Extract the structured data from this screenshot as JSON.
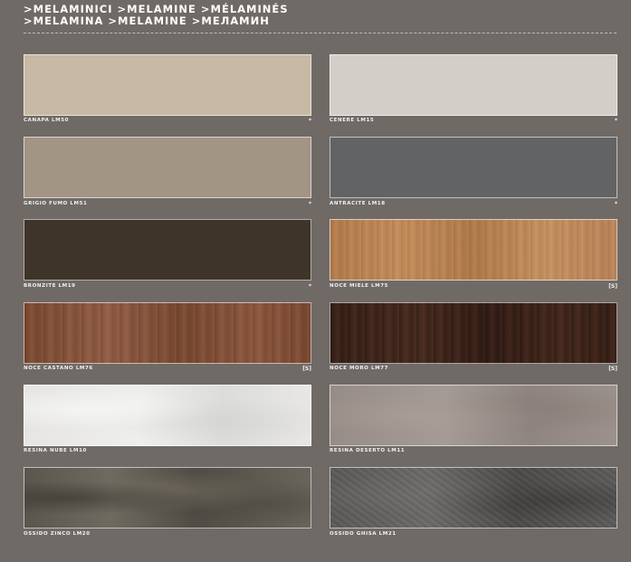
{
  "header": {
    "line1": ">MELAMINICI >MELAMINE >MÉLAMINÉS",
    "line2": ">MELAMINA >MELAMINE >МЕЛАМИН"
  },
  "swatches": [
    {
      "label": "CANAPA LM50",
      "mark": "*",
      "color": "#c7b9a4"
    },
    {
      "label": "CENERE LM15",
      "mark": "*",
      "color": "#d1cfc8"
    },
    {
      "label": "GRIGIO FUMO LM51",
      "mark": "*",
      "color": "#a29584"
    },
    {
      "label": "ANTRACITE LM18",
      "mark": "*",
      "color": "#626364"
    },
    {
      "label": "BRONZITE LM19",
      "mark": "*",
      "color": "#3f3429"
    },
    {
      "label": "NOCE MIELE LM75",
      "mark": "[S]",
      "color": "#b98455"
    },
    {
      "label": "NOCE CASTANO LM76",
      "mark": "[S]",
      "color": "#83513a"
    },
    {
      "label": "NOCE MORO LM77",
      "mark": "[S]",
      "color": "#3e261c"
    },
    {
      "label": "RESINA NUBE LM10",
      "mark": "",
      "color": "#e6e5e3"
    },
    {
      "label": "RESINA DESERTO LM11",
      "mark": "",
      "color": "#978c87"
    },
    {
      "label": "OSSIDO ZINCO LM20",
      "mark": "",
      "color": "#5f5b52"
    },
    {
      "label": "OSSIDO GHISA LM21",
      "mark": "",
      "color": "#5f5d5b"
    }
  ],
  "colors": {
    "background": "#6f6a66",
    "text": "#ffffff"
  }
}
